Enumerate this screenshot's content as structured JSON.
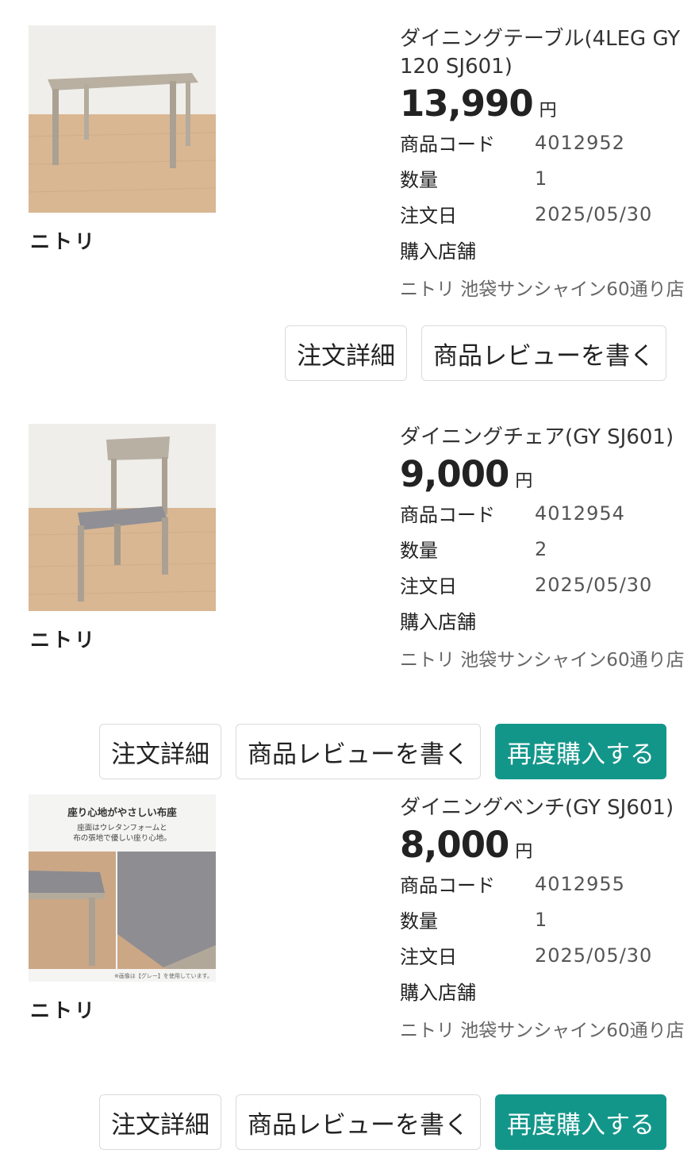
{
  "labels": {
    "code": "商品コード",
    "qty": "数量",
    "date": "注文日",
    "store": "購入店舗",
    "yen": "円",
    "order_detail": "注文詳細",
    "write_review": "商品レビューを書く",
    "rebuy": "再度購入する"
  },
  "products": [
    {
      "name": "ダイニングテーブル(4LEG GY 120 SJ601)",
      "brand": "ニトリ",
      "price": "13,990",
      "code": "4012952",
      "qty": "1",
      "date": "2025/05/30",
      "store_name": "ニトリ 池袋サンシャイン60通り店",
      "image": "table-photo"
    },
    {
      "name": "ダイニングチェア(GY SJ601)",
      "brand": "ニトリ",
      "price": "9,000",
      "code": "4012954",
      "qty": "2",
      "date": "2025/05/30",
      "store_name": "ニトリ 池袋サンシャイン60通り店",
      "image": "chair-photo"
    },
    {
      "name": "ダイニングベンチ(GY SJ601)",
      "brand": "ニトリ",
      "price": "8,000",
      "code": "4012955",
      "qty": "1",
      "date": "2025/05/30",
      "store_name": "ニトリ 池袋サンシャイン60通り店",
      "image": "bench-photo",
      "image_text": {
        "headline": "座り心地がやさしい布座",
        "line1": "座面はウレタンフォームと",
        "line2": "布の張地で優しい座り心地。",
        "note": "※画像は【グレー】を使用しています。"
      }
    }
  ],
  "colors": {
    "accent": "#13968a",
    "border": "#dadada"
  }
}
